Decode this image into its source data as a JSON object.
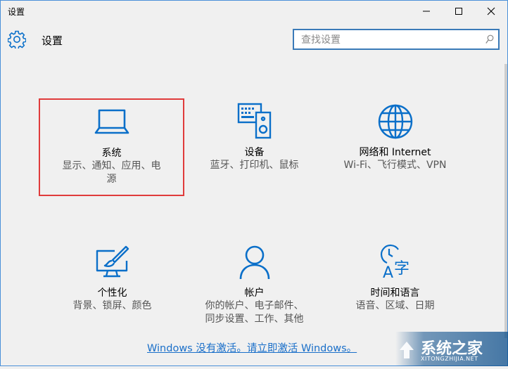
{
  "window": {
    "title": "设置"
  },
  "header": {
    "title": "设置"
  },
  "search": {
    "placeholder": "查找设置"
  },
  "tiles": [
    {
      "name": "系统",
      "desc_lines": [
        "显示、通知、应用、电",
        "源"
      ]
    },
    {
      "name": "设备",
      "desc_lines": [
        "蓝牙、打印机、鼠标"
      ]
    },
    {
      "name": "网络和 Internet",
      "desc_lines": [
        "Wi-Fi、飞行模式、VPN"
      ]
    },
    {
      "name": "个性化",
      "desc_lines": [
        "背景、锁屏、颜色"
      ]
    },
    {
      "name": "帐户",
      "desc_lines": [
        "你的帐户、电子邮件、",
        "同步设置、工作、其他"
      ]
    },
    {
      "name": "时间和语言",
      "desc_lines": [
        "语音、区域、日期"
      ]
    }
  ],
  "activation": {
    "text": "Windows 没有激活。请立即激活 Windows。"
  },
  "watermark": {
    "brand": "系统之家",
    "url": "XITONGZHIJIA.NET"
  },
  "colors": {
    "accent": "#0a6fc9",
    "selection": "#e03b3b",
    "link": "#1a6fc9"
  },
  "icons": {
    "tile0": "laptop-icon",
    "tile1": "keyboard-speaker-icon",
    "tile2": "globe-icon",
    "tile3": "monitor-brush-icon",
    "tile4": "person-icon",
    "tile5": "clock-language-icon"
  }
}
